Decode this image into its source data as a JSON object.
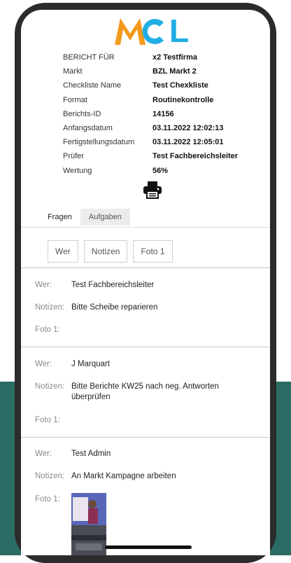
{
  "logo": {
    "letters_mc": "MC",
    "letter_l": "L"
  },
  "report": [
    {
      "key": "BERICHT FÜR",
      "value": "x2 Testfirma"
    },
    {
      "key": "Markt",
      "value": "BZL Markt 2"
    },
    {
      "key": "Checkliste Name",
      "value": "Test Chexkliste"
    },
    {
      "key": "Format",
      "value": "Routinekontrolle"
    },
    {
      "key": "Berichts-ID",
      "value": "14156"
    },
    {
      "key": "Anfangsdatum",
      "value": "03.11.2022 12:02:13"
    },
    {
      "key": "Fertigstellungsdatum",
      "value": "03.11.2022 12:05:01"
    },
    {
      "key": "Prüfer",
      "value": "Test Fachbereichsleiter"
    },
    {
      "key": "Wertung",
      "value": "56%"
    }
  ],
  "tabs": [
    "Fragen",
    "Aufgaben"
  ],
  "filters": [
    "Wer",
    "Notizen",
    "Foto 1"
  ],
  "labels": {
    "wer": "Wer:",
    "notizen": "Notizen:",
    "foto": "Foto 1:"
  },
  "records": [
    {
      "wer": "Test Fachbereichsleiter",
      "notizen": "Bitte Scheibe reparieren",
      "foto": ""
    },
    {
      "wer": "J Marquart",
      "notizen": "Bitte Berichte KW25 nach neg. Antworten überprüfen",
      "foto": ""
    },
    {
      "wer": "Test Admin",
      "notizen": "An Markt Kampagne arbeiten",
      "foto": "photo"
    }
  ],
  "icons": {
    "print": "printer-icon"
  },
  "colors": {
    "logo_orange": "#f39a1d",
    "logo_blue": "#20aee4",
    "background_teal": "#2a6b64"
  }
}
